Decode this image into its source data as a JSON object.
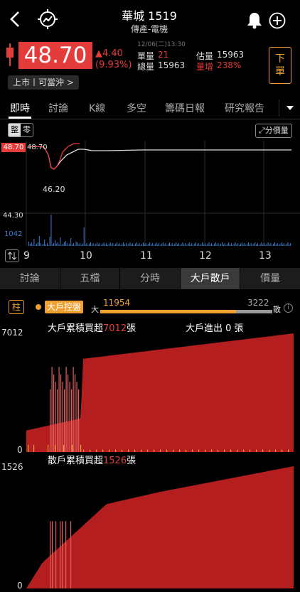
{
  "header": {
    "stock_name": "華城 1519",
    "industry": "傳產-電機",
    "datetime": "12/06(二)13:30"
  },
  "quote": {
    "price": "48.70",
    "change": "▲4.40",
    "change_pct": "(9.93%)",
    "unit_volume_label": "單量",
    "unit_volume": "21",
    "total_volume_label": "總量",
    "total_volume": "15963",
    "est_volume_label": "估量",
    "est_volume": "15963",
    "volume_increase_label": "量增",
    "volume_increase": "238%",
    "order_button": "下單",
    "market_tag": "上市丨可當沖 >"
  },
  "tabs": [
    "即時",
    "討論",
    "K線",
    "多空",
    "籌碼日報",
    "研究報告"
  ],
  "intraday": {
    "mode_whole": "整",
    "mode_odd": "零",
    "price_volume_button": "分價量",
    "price_tag": "48.70",
    "price_label": "48.70",
    "low_label": "46.20",
    "vol_max": "44.30",
    "vol_label": "1042",
    "time_labels": [
      "9",
      "10",
      "11",
      "12",
      "13"
    ]
  },
  "subtabs": [
    "討論",
    "五檔",
    "分時",
    "大戶散戶",
    "價量"
  ],
  "big_retail": {
    "column_button": "柱",
    "control_badge": "大戶控盤",
    "big_label": "大",
    "big_value": "11954",
    "retail_value": "3222",
    "retail_label": "散",
    "info_icon": "info-icon",
    "chart1_prefix": "大戶累積買超",
    "chart1_value": "7012",
    "chart1_suffix": "張",
    "chart1_inout": "大戶進出 0 張",
    "chart1_ymax": "7012",
    "chart1_ymin": "0",
    "chart2_prefix": "散戶累積買超",
    "chart2_value": "1526",
    "chart2_suffix": "張",
    "chart2_ymax": "1526",
    "chart2_ymin": "0"
  },
  "colors": {
    "accent_red": "#e43b3b",
    "fill_red": "#b51e1e",
    "orange": "#f0a030",
    "blue": "#3a7fd5"
  }
}
